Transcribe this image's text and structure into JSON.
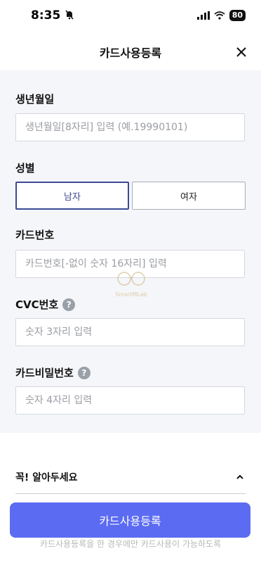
{
  "status_bar": {
    "time": "8:35",
    "battery": "80"
  },
  "header": {
    "title": "카드사용등록"
  },
  "form": {
    "birth": {
      "label": "생년월일",
      "placeholder": "생년월일[8자리] 입력 (예.19990101)"
    },
    "gender": {
      "label": "성별",
      "male": "남자",
      "female": "여자",
      "selected": "남자"
    },
    "card_number": {
      "label": "카드번호",
      "placeholder": "카드번호[-없이 숫자 16자리] 입력"
    },
    "cvc": {
      "label": "CVC번호",
      "help": "?",
      "placeholder": "숫자 3자리 입력"
    },
    "card_password": {
      "label": "카드비밀번호",
      "help": "?",
      "placeholder": "숫자 4자리 입력"
    }
  },
  "watermark": "SmartMLab",
  "notice": {
    "title": "꼭! 알아두세요",
    "text": "카드사용등록을 한 경우에만 카드사용이 가능하도록"
  },
  "submit": {
    "label": "카드사용등록"
  },
  "colors": {
    "accent": "#5b6bf2",
    "selected_border": "#3b4a96",
    "form_bg": "#f5f6f9"
  }
}
